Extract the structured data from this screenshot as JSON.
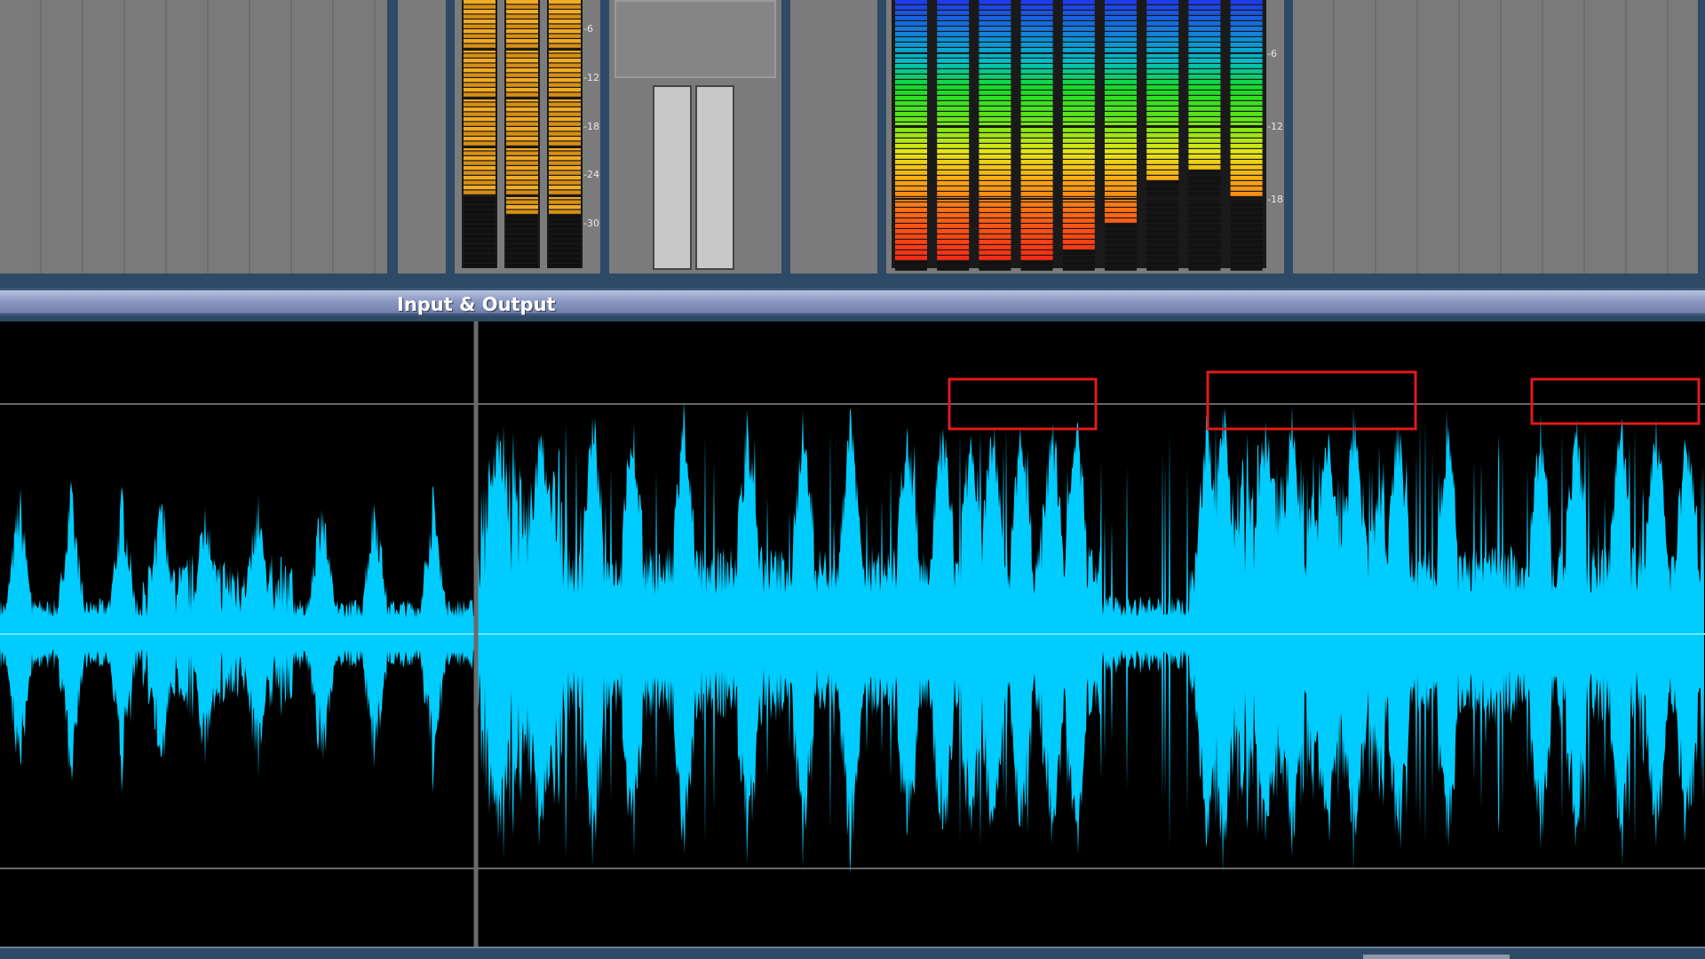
{
  "section": {
    "title": "Input & Output"
  },
  "meters": {
    "input_db_labels": [
      "-6",
      "-12",
      "-18",
      "-24",
      "-30"
    ],
    "output_db_labels": [
      "-6",
      "-12",
      "-18"
    ],
    "input_levels": [
      0.72,
      0.8,
      0.8
    ],
    "output_levels": [
      0.97,
      0.97,
      0.97,
      0.97,
      0.93,
      0.82,
      0.67,
      0.62,
      0.72
    ]
  },
  "colors": {
    "waveform": "#00ccff",
    "highlight_box": "#e21a1a",
    "input_meter": "#e8a21a",
    "background": "#000000"
  }
}
